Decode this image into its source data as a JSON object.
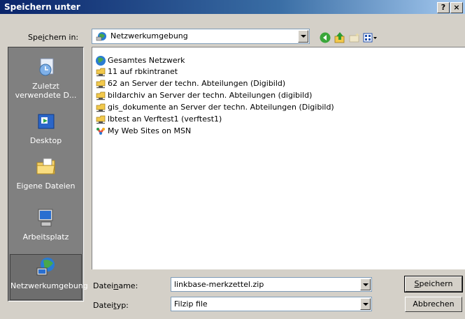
{
  "window": {
    "title": "Speichern unter",
    "help_label": "?",
    "close_label": "×"
  },
  "location": {
    "label_pre": "Spe",
    "label_u": "i",
    "label_post": "chern in:",
    "value": "Netzwerkumgebung"
  },
  "toolbar": {
    "icons": [
      "back-icon",
      "up-folder-icon",
      "new-folder-icon",
      "view-menu-icon"
    ]
  },
  "places": [
    {
      "label": "Zuletzt verwendete D...",
      "icon": "recent-icon"
    },
    {
      "label": "Desktop",
      "icon": "desktop-icon"
    },
    {
      "label": "Eigene Dateien",
      "icon": "folder-icon"
    },
    {
      "label": "Arbeitsplatz",
      "icon": "computer-icon"
    },
    {
      "label": "Netzwerkumgebung",
      "icon": "network-icon",
      "selected": true
    }
  ],
  "files": [
    {
      "label": "Gesamtes Netzwerk",
      "icon": "globe-icon"
    },
    {
      "label": "11 auf rbkintranet",
      "icon": "network-share-icon"
    },
    {
      "label": "62 an Server der techn. Abteilungen (Digibild)",
      "icon": "network-share-icon"
    },
    {
      "label": "bildarchiv an Server der techn. Abteilungen (digibild)",
      "icon": "network-share-icon"
    },
    {
      "label": "gis_dokumente an Server der techn. Abteilungen (Digibild)",
      "icon": "network-share-icon"
    },
    {
      "label": "lbtest an Verftest1 (verftest1)",
      "icon": "network-share-icon"
    },
    {
      "label": "My Web Sites on MSN",
      "icon": "msn-icon"
    }
  ],
  "filename": {
    "label_pre": "Datei",
    "label_u": "n",
    "label_post": "ame:",
    "value": "linkbase-merkzettel.zip"
  },
  "filetype": {
    "label_pre": "Datei",
    "label_u": "t",
    "label_post": "yp:",
    "value": "Filzip file"
  },
  "buttons": {
    "save_u": "S",
    "save_post": "peichern",
    "cancel": "Abbrechen"
  },
  "colors": {
    "titlebar": "#0a246a",
    "dialog": "#d4d0c8",
    "places_bar": "#808080"
  }
}
